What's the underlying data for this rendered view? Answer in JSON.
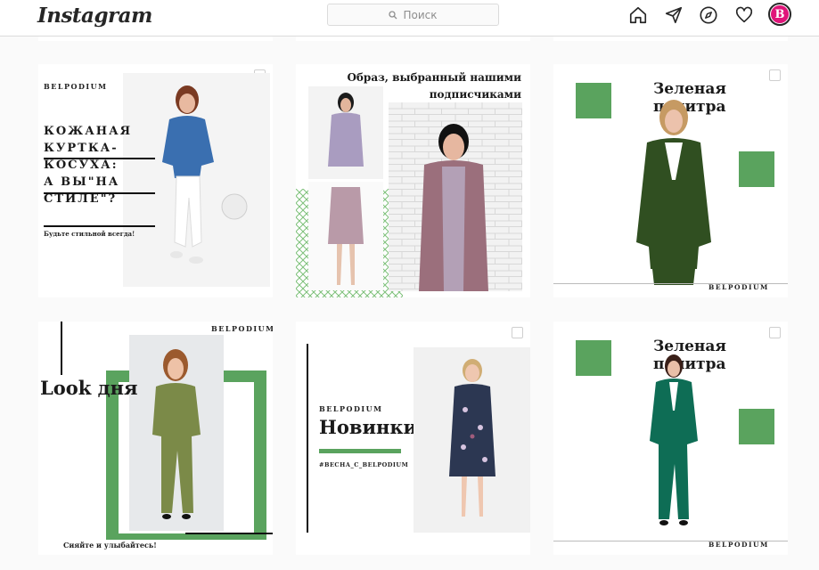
{
  "header": {
    "logo": "Instagram",
    "search_placeholder": "Поиск",
    "avatar_letter": "B",
    "icons": [
      "home-icon",
      "direct-icon",
      "explore-icon",
      "heart-icon"
    ]
  },
  "colors": {
    "accent_green": "#5aa35e",
    "avatar_pink": "#e0157a"
  },
  "posts": [
    {
      "brand": "BELPODIUM",
      "headline_lines": [
        "КОЖАНАЯ",
        "КУРТКА-",
        "КОСУХА:",
        "А ВЫ\"НА",
        "СТИЛЕ\"?"
      ],
      "subtitle": "Будьте стильной всегда!"
    },
    {
      "title_line1": "Образ, выбранный нашими",
      "title_line2": "подписчиками"
    },
    {
      "title": "Зеленая палитра",
      "brand": "BELPODIUM"
    },
    {
      "brand": "BELPODIUM",
      "title": "Look дня",
      "caption": "Сияйте и улыбайтесь!"
    },
    {
      "brand": "BELPODIUM",
      "title": "Новинки",
      "hashtag": "#ВЕСНА_С_BELPODIUM"
    },
    {
      "title": "Зеленая палитра",
      "brand": "BELPODIUM"
    }
  ]
}
